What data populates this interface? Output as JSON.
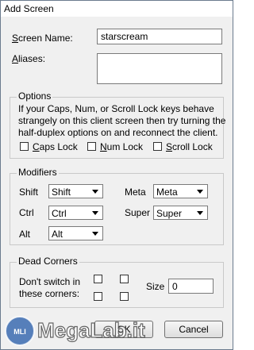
{
  "window": {
    "title": "Add Screen"
  },
  "screen_name": {
    "label": "Screen Name:",
    "value": "starscream"
  },
  "aliases": {
    "label": "Aliases:",
    "value": ""
  },
  "options": {
    "legend": "Options",
    "description_lines": [
      "If your Caps, Num, or Scroll Lock keys behave",
      "strangely on this client screen then try turning the",
      "half-duplex options on and reconnect the client."
    ],
    "caps_lock": {
      "label": "Caps Lock",
      "checked": false
    },
    "num_lock": {
      "label": "Num Lock",
      "checked": false
    },
    "scroll_lock": {
      "label": "Scroll Lock",
      "checked": false
    }
  },
  "modifiers": {
    "legend": "Modifiers",
    "shift": {
      "label": "Shift",
      "value": "Shift"
    },
    "ctrl": {
      "label": "Ctrl",
      "value": "Ctrl"
    },
    "alt": {
      "label": "Alt",
      "value": "Alt"
    },
    "meta": {
      "label": "Meta",
      "value": "Meta"
    },
    "super": {
      "label": "Super",
      "value": "Super"
    }
  },
  "dead_corners": {
    "legend": "Dead Corners",
    "line1": "Don't switch in",
    "line2": "these corners:",
    "size_label": "Size",
    "size_value": "0"
  },
  "buttons": {
    "ok": "OK",
    "cancel": "Cancel"
  },
  "watermark": {
    "text": "MegaLab.it",
    "badge": "MLI"
  }
}
